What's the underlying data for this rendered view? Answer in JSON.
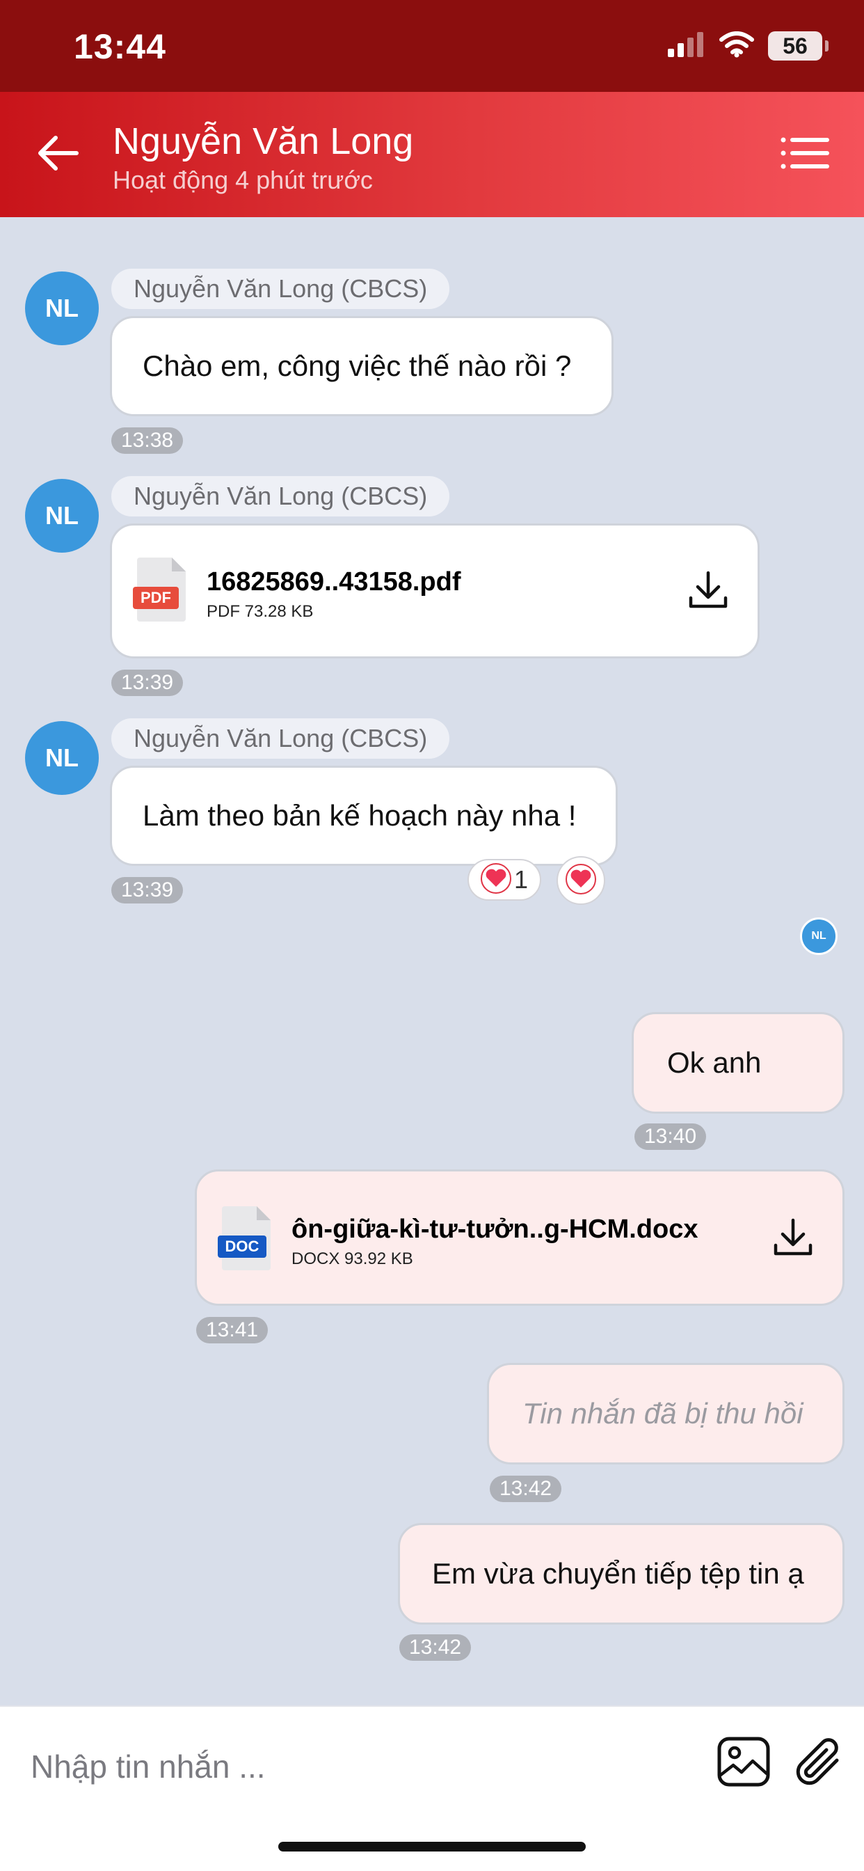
{
  "status_bar": {
    "time": "13:44",
    "battery": "56",
    "icons": [
      "signal-icon",
      "wifi-icon",
      "battery-icon"
    ]
  },
  "header": {
    "title": "Nguyễn Văn Long",
    "subtitle": "Hoạt động 4 phút trước",
    "icons": [
      "back-arrow-icon",
      "menu-icon"
    ]
  },
  "colors": {
    "header_start": "#c8141a",
    "header_end": "#f5525a",
    "status_bar": "#8b0e0e",
    "chat_background": "#d8deea",
    "avatar": "#3b98dd",
    "outgoing_bubble": "#fdecec",
    "pdf_badge": "#e74c3c",
    "doc_badge": "#1559c4"
  },
  "messages": {
    "m1": {
      "avatar": "NL",
      "sender": "Nguyễn Văn Long (CBCS)",
      "text": "Chào em, công việc thế nào rồi ?",
      "time": "13:38"
    },
    "m2": {
      "avatar": "NL",
      "sender": "Nguyễn Văn Long (CBCS)",
      "file_badge": "PDF",
      "file_name": "16825869..43158.pdf",
      "file_meta": "PDF 73.28 KB",
      "time": "13:39"
    },
    "m3": {
      "avatar": "NL",
      "sender": "Nguyễn Văn Long (CBCS)",
      "text": "Làm theo bản kế hoạch này nha !",
      "time": "13:39",
      "reaction_count": "1"
    },
    "seen_avatar": "NL",
    "m4": {
      "text": "Ok anh",
      "time": "13:40"
    },
    "m5": {
      "file_badge": "DOC",
      "file_name": "ôn-giữa-kì-tư-tưởn..g-HCM.docx",
      "file_meta": "DOCX 93.92 KB",
      "time": "13:41"
    },
    "m6": {
      "text": "Tin nhắn đã bị thu hồi",
      "time": "13:42"
    },
    "m7": {
      "text": "Em vừa chuyển tiếp tệp tin ạ",
      "time": "13:42"
    }
  },
  "input": {
    "placeholder": "Nhập tin nhắn ...",
    "icons": [
      "image-icon",
      "attachment-icon"
    ]
  }
}
